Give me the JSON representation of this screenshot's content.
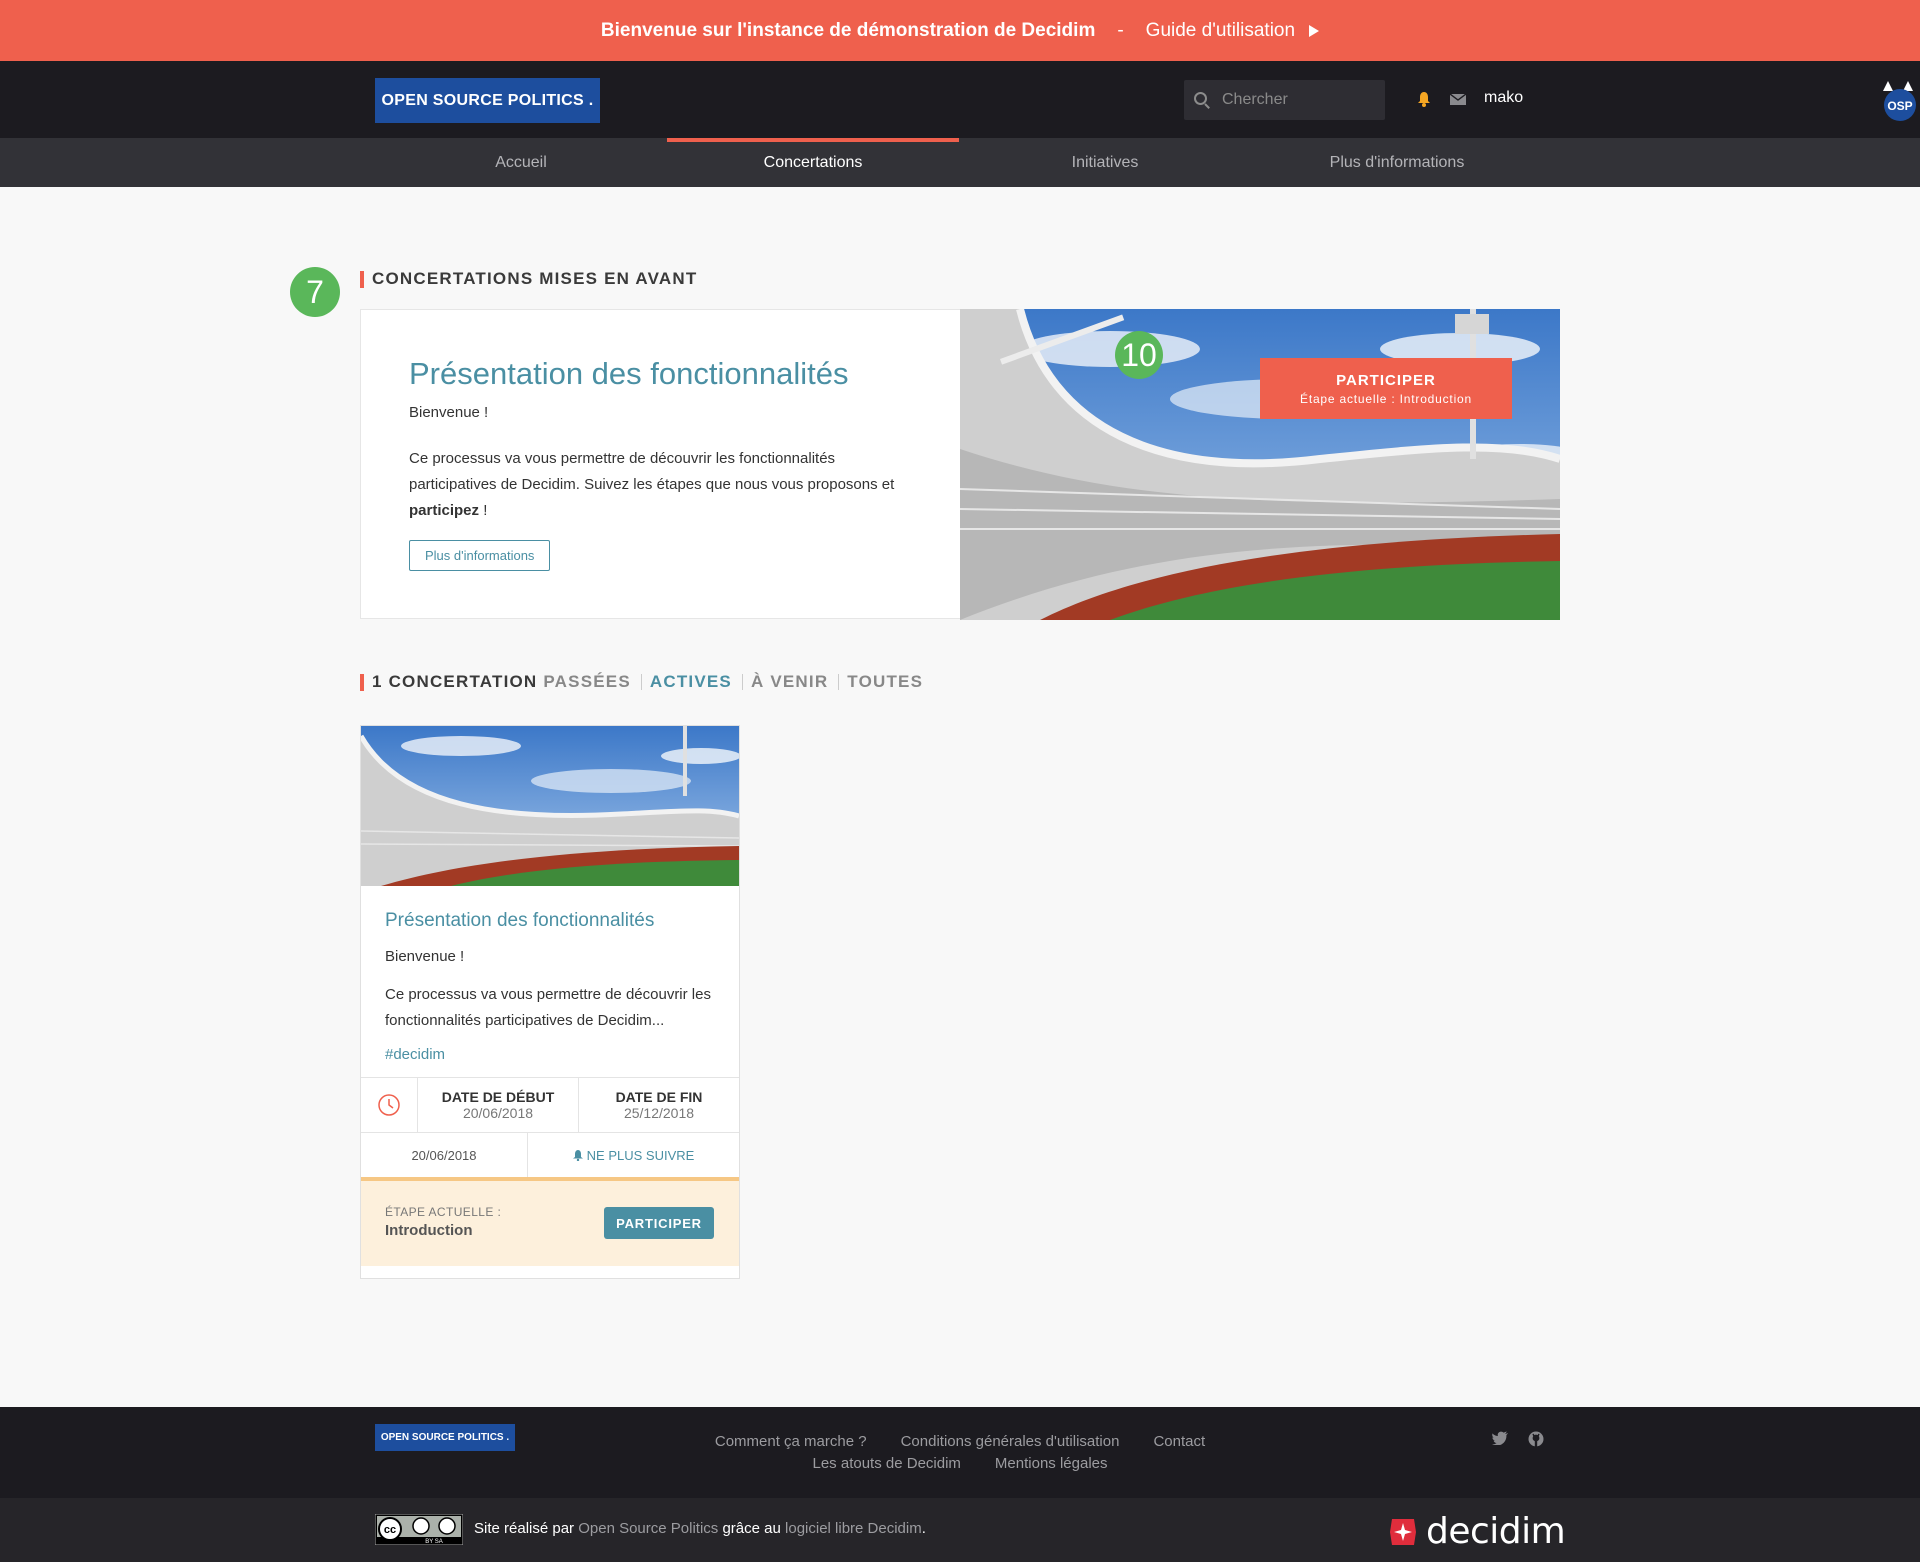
{
  "banner": {
    "welcome": "Bienvenue sur l'instance de démonstration de Decidim",
    "separator": "-",
    "guide": "Guide d'utilisation"
  },
  "header": {
    "logo_label": "OPEN SOURCE POLITICS .",
    "search_placeholder": "Chercher",
    "username": "mako",
    "badge_text": "OSP"
  },
  "nav": {
    "items": [
      {
        "label": "Accueil"
      },
      {
        "label": "Concertations"
      },
      {
        "label": "Initiatives"
      },
      {
        "label": "Plus d'informations"
      }
    ]
  },
  "featured": {
    "badge_count": "7",
    "section_title": "CONCERTATIONS MISES EN AVANT",
    "title": "Présentation des fonctionnalités",
    "intro": "Bienvenue !",
    "description": "Ce processus va vous permettre de découvrir les fonctionnalités participatives de Decidim. Suivez les étapes que nous vous proposons et",
    "description_bold": "participez",
    "description_end": " !",
    "more_button": "Plus d'informations",
    "image_badge": "10",
    "participate_label": "PARTICIPER",
    "current_step": "Étape actuelle : Introduction"
  },
  "filters": {
    "count": "1 CONCERTATION",
    "items": [
      "PASSÉES",
      "ACTIVES",
      "À VENIR",
      "TOUTES"
    ],
    "active": "ACTIVES"
  },
  "card": {
    "title": "Présentation des fonctionnalités",
    "intro": "Bienvenue !",
    "excerpt": "Ce processus va vous permettre de découvrir les fonctionnalités participatives de Decidim...",
    "tag": "#decidim",
    "start_label": "DATE DE DÉBUT",
    "start_date": "20/06/2018",
    "end_label": "DATE DE FIN",
    "end_date": "25/12/2018",
    "meta_date": "20/06/2018",
    "unfollow": "NE PLUS SUIVRE",
    "step_label": "ÉTAPE ACTUELLE :",
    "step_value": "Introduction",
    "participate": "PARTICIPER"
  },
  "footer": {
    "logo_label": "OPEN SOURCE POLITICS .",
    "links_row1": [
      "Comment ça marche ?",
      "Conditions générales d'utilisation",
      "Contact"
    ],
    "links_row2": [
      "Les atouts de Decidim",
      "Mentions légales"
    ],
    "credit_pre": "Site réalisé par ",
    "credit_link1": "Open Source Politics",
    "credit_mid": " grâce au ",
    "credit_link2": "logiciel libre Decidim",
    "credit_end": ".",
    "brand": "decidim",
    "cc_text": "BY SA"
  },
  "colors": {
    "accent": "#ef604d",
    "primary": "#4a8fa3",
    "logo_blue": "#1d4e9e",
    "badge_green": "#5ab75a",
    "dark": "#1c1b20"
  }
}
